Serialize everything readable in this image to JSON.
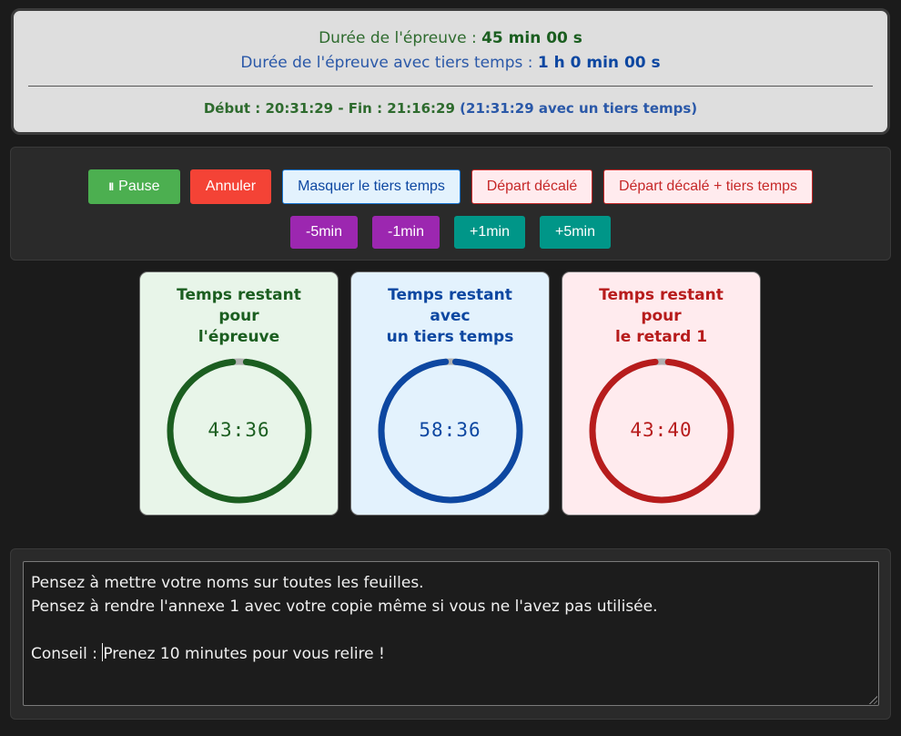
{
  "header": {
    "duration_label": "Durée de l'épreuve : ",
    "duration_value": "45 min 00 s",
    "tiers_label": "Durée de l'épreuve avec tiers temps : ",
    "tiers_value": "1 h 0 min 00 s",
    "schedule_main": "Début : 20:31:29 - Fin : 21:16:29",
    "schedule_tiers": "(21:31:29 avec un tiers temps)"
  },
  "controls": {
    "pause_icon": "II",
    "pause_label": "Pause",
    "cancel_label": "Annuler",
    "mask_label": "Masquer le tiers temps",
    "delay_label": "Départ décalé",
    "delay_tiers_label": "Départ décalé + tiers temps",
    "minus5_label": "-5min",
    "minus1_label": "-1min",
    "plus1_label": "+1min",
    "plus5_label": "+5min"
  },
  "timers": [
    {
      "title_lines": [
        "Temps restant",
        "pour",
        "l'épreuve"
      ],
      "time": "43:36",
      "remaining_fraction": 0.969,
      "color": "#1b5e20"
    },
    {
      "title_lines": [
        "Temps restant",
        "avec",
        "un tiers temps"
      ],
      "time": "58:36",
      "remaining_fraction": 0.977,
      "color": "#0d47a1"
    },
    {
      "title_lines": [
        "Temps restant",
        "pour",
        "le retard 1"
      ],
      "time": "43:40",
      "remaining_fraction": 0.97,
      "color": "#b71c1c"
    }
  ],
  "notes": {
    "line1": "Pensez à mettre votre noms sur toutes les feuilles.",
    "line2": "Pensez à rendre l'annexe 1 avec votre copie même si vous ne l'avez pas utilisée.",
    "line3_prefix": "Conseil : ",
    "line3_rest": "Prenez 10 minutes pour vous relire !"
  },
  "colors": {
    "pause": "#4caf50",
    "cancel": "#f44336",
    "minus": "#9c27b0",
    "plus": "#009688",
    "ring_track": "#b0b0b0"
  }
}
